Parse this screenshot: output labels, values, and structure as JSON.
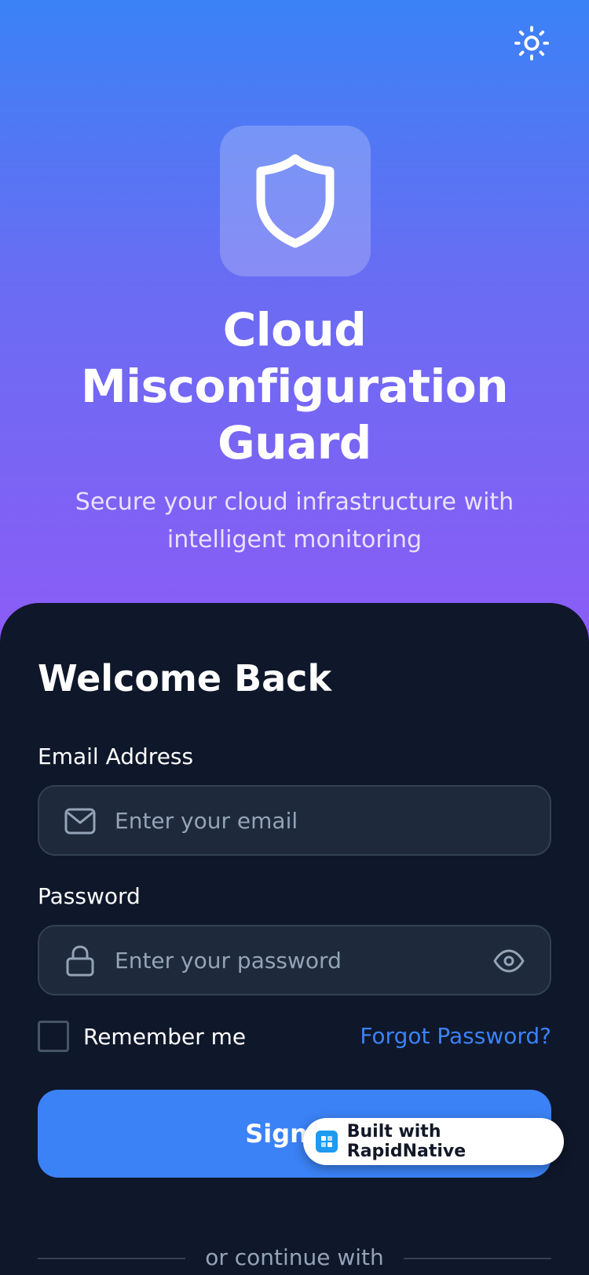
{
  "header": {
    "theme_toggle_icon": "sun-icon",
    "logo_icon": "shield-icon",
    "app_title": "Cloud Misconfiguration Guard",
    "app_subtitle": "Secure your cloud infrastructure with intelligent monitoring"
  },
  "login": {
    "heading": "Welcome Back",
    "email": {
      "label": "Email Address",
      "placeholder": "Enter your email",
      "value": "",
      "icon": "mail-icon"
    },
    "password": {
      "label": "Password",
      "placeholder": "Enter your password",
      "value": "",
      "icon": "lock-icon",
      "toggle_icon": "eye-icon"
    },
    "remember_me": {
      "label": "Remember me",
      "checked": false
    },
    "forgot_password": "Forgot Password?",
    "sign_in_button": "Sign In",
    "divider_text": "or continue with"
  },
  "badge": {
    "text": "Built with RapidNative",
    "icon": "rapidnative-logo-icon"
  },
  "colors": {
    "gradient_top": "#3b82f6",
    "gradient_bottom": "#8b5cf6",
    "card_bg": "#0f172a",
    "input_bg": "#1e293b",
    "accent": "#3b82f6"
  }
}
